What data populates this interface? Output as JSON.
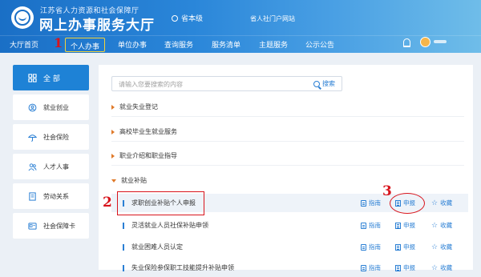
{
  "header": {
    "org_name": "江苏省人力资源和社会保障厅",
    "site_name": "网上办事服务大厅",
    "level": "省本级",
    "portal_link": "省人社门户网站"
  },
  "nav": {
    "items": [
      "大厅首页",
      "个人办事",
      "单位办事",
      "查询服务",
      "服务清单",
      "主题服务",
      "公示公告"
    ],
    "active_index": 1
  },
  "sidebar": {
    "items": [
      {
        "label": "全 部",
        "icon": "grid-icon"
      },
      {
        "label": "就业创业",
        "icon": "employment-icon"
      },
      {
        "label": "社会保险",
        "icon": "umbrella-icon"
      },
      {
        "label": "人才人事",
        "icon": "people-icon"
      },
      {
        "label": "劳动关系",
        "icon": "document-icon"
      },
      {
        "label": "社会保障卡",
        "icon": "card-icon"
      }
    ],
    "active_index": 0
  },
  "search": {
    "placeholder": "请输入您要搜索的内容",
    "button_label": "搜索"
  },
  "categories": [
    {
      "label": "就业失业登记",
      "expanded": false
    },
    {
      "label": "高校毕业生就业服务",
      "expanded": false
    },
    {
      "label": "职业介绍和职业指导",
      "expanded": false
    },
    {
      "label": "就业补贴",
      "expanded": true
    }
  ],
  "services": [
    {
      "name": "求职创业补贴个人申报",
      "highlighted": true
    },
    {
      "name": "灵活就业人员社保补贴申领",
      "highlighted": false
    },
    {
      "name": "就业困难人员认定",
      "highlighted": false
    },
    {
      "name": "失业保险参保职工技能提升补贴申领",
      "highlighted": false
    }
  ],
  "actions": {
    "guide": "指南",
    "apply": "申报",
    "favorite": "收藏"
  },
  "annotations": {
    "step1": "1",
    "step2": "2",
    "step3": "3",
    "color": "#d8141c"
  },
  "colors": {
    "header_blue": "#1a6fc6",
    "accent": "#2a7fd4",
    "sidebar_active": "#1e82d6",
    "category_arrow": "#e07a2a"
  }
}
